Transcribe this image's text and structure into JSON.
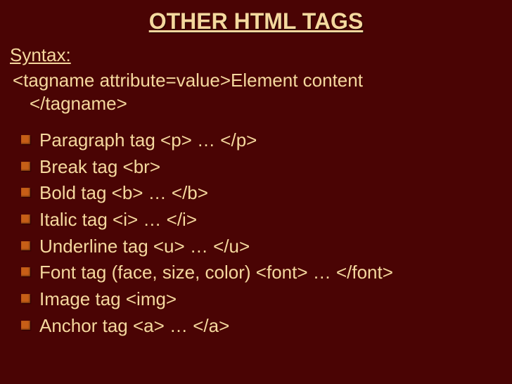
{
  "title": "OTHER HTML TAGS",
  "syntax_label": "Syntax:",
  "syntax_open": "<tagname attribute=value>Element content",
  "syntax_close": "</tagname>",
  "items": [
    "Paragraph tag  <p>  …  </p>",
    "Break tag  <br>",
    "Bold tag  <b> … </b>",
    "Italic tag  <i> … </i>",
    "Underline tag  <u> … </u>",
    "Font tag (face, size, color)  <font> … </font>",
    "Image tag  <img>",
    "Anchor tag <a> … </a>"
  ]
}
